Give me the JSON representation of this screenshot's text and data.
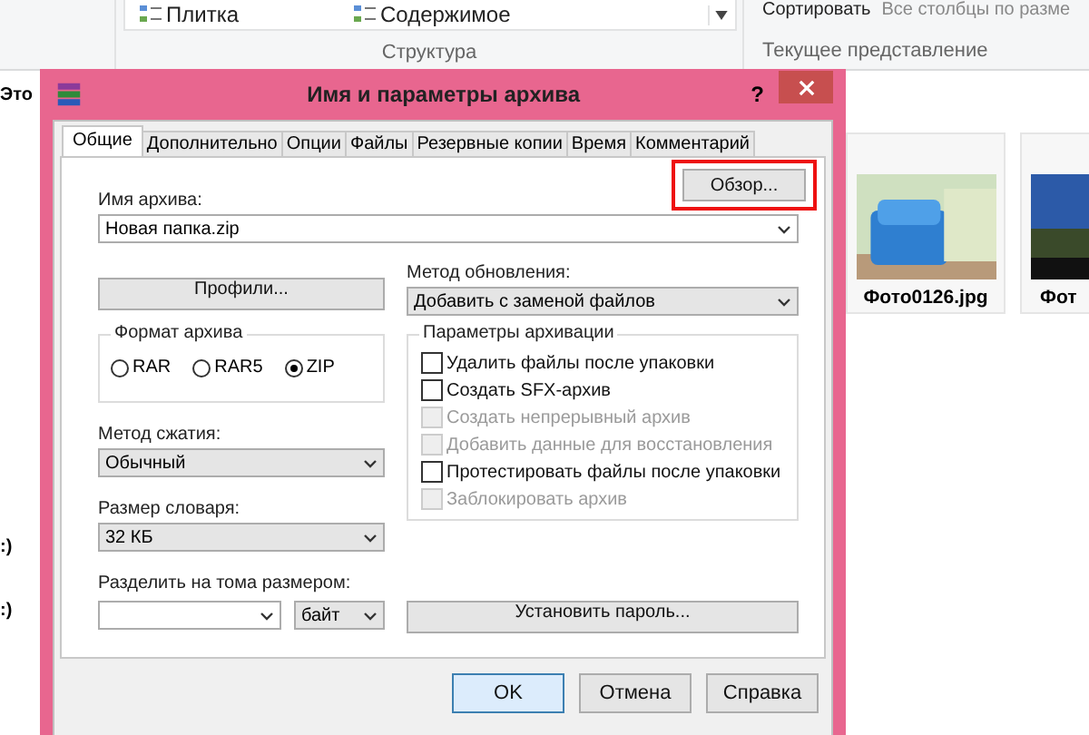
{
  "ribbon": {
    "layout_items": [
      {
        "label": "Плитка"
      },
      {
        "label": "Содержимое"
      }
    ],
    "layout_group": "Структура",
    "sort_label": "Сортировать",
    "fit_columns": "Все столбцы по разме",
    "view_group": "Текущее представление"
  },
  "nav_items": [
    "Это",
    ":)",
    ":)"
  ],
  "files": [
    {
      "name": "Фото0126.jpg",
      "kind": "picture"
    },
    {
      "name": "Фот",
      "kind": "picture"
    }
  ],
  "dialog": {
    "title": "Имя и параметры архива",
    "help_glyph": "?",
    "tabs": [
      {
        "label": "Общие",
        "selected": true
      },
      {
        "label": "Дополнительно",
        "selected": false
      },
      {
        "label": "Опции",
        "selected": false
      },
      {
        "label": "Файлы",
        "selected": false
      },
      {
        "label": "Резервные копии",
        "selected": false
      },
      {
        "label": "Время",
        "selected": false
      },
      {
        "label": "Комментарий",
        "selected": false
      }
    ],
    "archive_name_label": "Имя архива:",
    "browse_button": "Обзор...",
    "browse_highlighted": true,
    "archive_name": "Новая папка.zip",
    "profiles_button": "Профили...",
    "update_method_label": "Метод обновления:",
    "update_method": "Добавить с заменой файлов",
    "format_group": "Формат архива",
    "formats": [
      {
        "label": "RAR",
        "selected": false
      },
      {
        "label": "RAR5",
        "selected": false
      },
      {
        "label": "ZIP",
        "selected": true
      }
    ],
    "options_group": "Параметры архивации",
    "options": [
      {
        "label": "Удалить файлы после упаковки",
        "checked": false,
        "disabled": false
      },
      {
        "label": "Создать SFX-архив",
        "checked": false,
        "disabled": false
      },
      {
        "label": "Создать непрерывный архив",
        "checked": false,
        "disabled": true
      },
      {
        "label": "Добавить данные для восстановления",
        "checked": false,
        "disabled": true
      },
      {
        "label": "Протестировать файлы после упаковки",
        "checked": false,
        "disabled": false
      },
      {
        "label": "Заблокировать архив",
        "checked": false,
        "disabled": true
      }
    ],
    "compression_label": "Метод сжатия:",
    "compression": "Обычный",
    "dictionary_label": "Размер словаря:",
    "dictionary": "32 КБ",
    "split_label": "Разделить на тома размером:",
    "split_unit": "байт",
    "password_button": "Установить пароль...",
    "buttons": [
      {
        "label": "OK",
        "default": true
      },
      {
        "label": "Отмена",
        "default": false
      },
      {
        "label": "Справка",
        "default": false
      }
    ]
  }
}
